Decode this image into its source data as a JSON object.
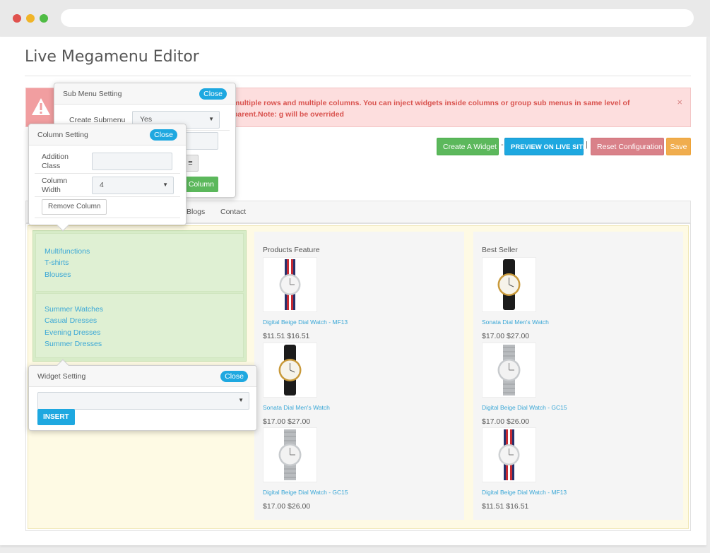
{
  "page": {
    "title": "Live Megamenu Editor"
  },
  "alert": {
    "text": "multiple rows and multiple columns. You can inject widgets inside columns or group sub menus in same level of parent.Note: g will be overrided",
    "close": "×"
  },
  "toolbar": {
    "create_widget": "Create A Widget",
    "sep1": "-",
    "preview": "PREVIEW ON LIVE SITE",
    "sep2": "|",
    "reset": "Reset Configuration",
    "save": "Save"
  },
  "menu": {
    "items": [
      "Blogs",
      "Contact"
    ]
  },
  "submenu_setting": {
    "title": "Sub Menu Setting",
    "close": "Close",
    "create_submenu_label": "Create Submenu",
    "create_submenu_value": "Yes",
    "align_icon": "≡",
    "add_column": "Column"
  },
  "column_setting": {
    "title": "Column Setting",
    "close": "Close",
    "addition_class_label": "Addition Class",
    "column_width_label": "Column Width",
    "column_width_value": "4",
    "remove_column": "Remove Column"
  },
  "widget_setting": {
    "title": "Widget Setting",
    "close": "Close",
    "select_value": "",
    "insert": "INSERT"
  },
  "links": {
    "group1": [
      "Multifunctions",
      "T-shirts",
      "Blouses"
    ],
    "group2": [
      "Summer Watches",
      "Casual Dresses",
      "Evening Dresses",
      "Summer Dresses"
    ]
  },
  "products_feature": {
    "title": "Products Feature",
    "items": [
      {
        "name": "Digital Beige Dial Watch - MF13",
        "price": "$11.51 $16.51",
        "icon": "striped-strap-watch"
      },
      {
        "name": "Sonata Dial Men's Watch",
        "price": "$17.00 $27.00",
        "icon": "black-leather-watch"
      },
      {
        "name": "Digital Beige Dial Watch - GC15",
        "price": "$17.00 $26.00",
        "icon": "mesh-strap-watch"
      }
    ]
  },
  "best_seller": {
    "title": "Best Seller",
    "items": [
      {
        "name": "Sonata Dial Men's Watch",
        "price": "$17.00 $27.00",
        "icon": "black-leather-watch"
      },
      {
        "name": "Digital Beige Dial Watch - GC15",
        "price": "$17.00 $26.00",
        "icon": "mesh-strap-watch"
      },
      {
        "name": "Digital Beige Dial Watch - MF13",
        "price": "$11.51 $16.51",
        "icon": "striped-strap-watch"
      }
    ]
  },
  "colors": {
    "accent_blue": "#1ea8e0",
    "success_green": "#5cb85c",
    "danger_pink": "#d98189",
    "warning_orange": "#f0ad4e",
    "alert_text": "#d9534f"
  }
}
